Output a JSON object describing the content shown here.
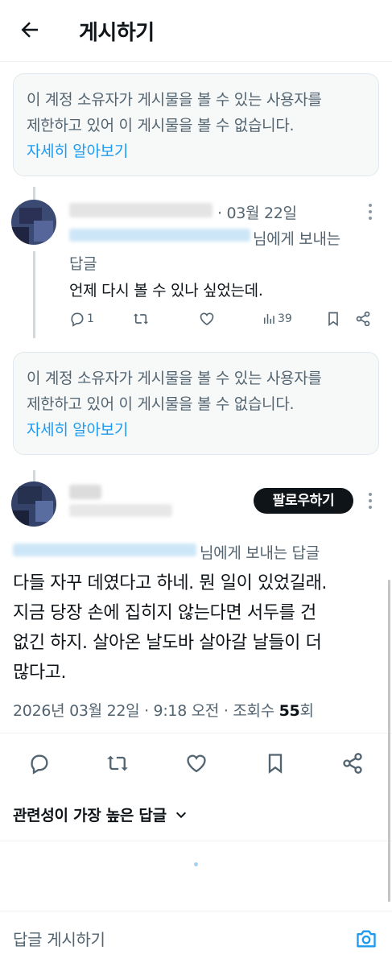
{
  "header": {
    "title": "게시하기"
  },
  "notice1": {
    "line1": "이 계정 소유자가 게시물을 볼 수 있는 사용자를",
    "line2": "제한하고 있어 이 게시물을 볼 수 없습니다.",
    "link": "자세히 알아보기"
  },
  "reply1": {
    "date": "· 03월 22일",
    "to_suffix": "님에게 보내는",
    "to_suffix2": "답글",
    "text": "언제 다시 볼 수 있나 싶었는데.",
    "reply_count": "1",
    "views": "39"
  },
  "notice2": {
    "line1": "이 계정 소유자가 게시물을 볼 수 있는 사용자를",
    "line2": "제한하고 있어 이 게시물을 볼 수 없습니다.",
    "link": "자세히 알아보기"
  },
  "main_post": {
    "follow_label": "팔로우하기",
    "to_suffix": "님에게 보내는 답글",
    "text_lines": [
      "다들 자꾸 데였다고 하네. 뭔 일이 있었길래.",
      "지금 당장 손에 집히지 않는다면 서두를 건",
      "없긴 하지. 살아온 날도바 살아갈 날들이 더",
      "많다고."
    ],
    "timestamp": "2026년 03월 22일 · 9:18 오전 · 조회수 ",
    "views": "55",
    "views_suffix": "회"
  },
  "relevance_label": "관련성이 가장 높은 답글",
  "composer": {
    "placeholder": "답글 게시하기"
  },
  "colors": {
    "accent": "#1d9bf0",
    "text": "#0f1419",
    "muted": "#536471",
    "button": "#0f1419"
  }
}
